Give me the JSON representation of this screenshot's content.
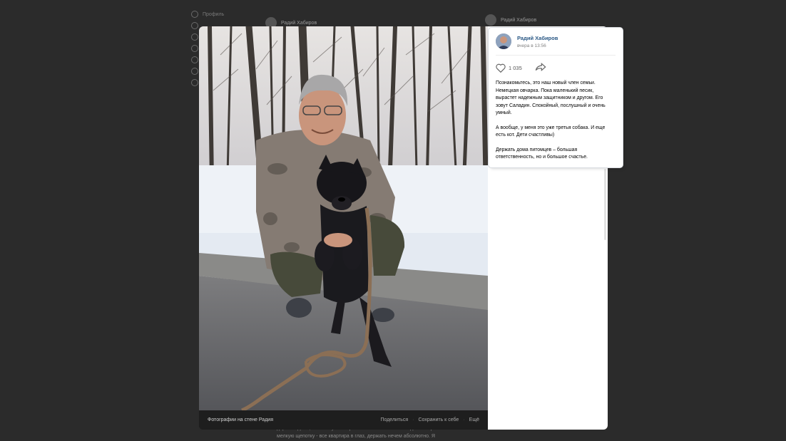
{
  "background": {
    "left_menu": [
      {
        "label": "Профиль"
      },
      {
        "label": ""
      },
      {
        "label": ""
      },
      {
        "label": ""
      },
      {
        "label": ""
      },
      {
        "label": ""
      },
      {
        "label": ""
      },
      {
        "label": ""
      },
      {
        "label": ""
      },
      {
        "label": ""
      },
      {
        "label": ""
      },
      {
        "label": ""
      },
      {
        "label": ""
      },
      {
        "label": ""
      }
    ],
    "post_author_left": "Радий Хабиров",
    "post_author_right": "Радий Хабиров",
    "post_text_under": "держите дело, что-то я уже творится в г. Салават. Сети в доме открыто на мелкую щепотку - все квартира в глаз, держать нечем абсолютно. Я"
  },
  "viewer": {
    "footer_title": "Фотографии на стене Радия",
    "footer_share": "Поделиться",
    "footer_save": "Сохранить к себе",
    "footer_more": "Ещё"
  },
  "post": {
    "author": "Радий Хабиров",
    "time": "вчера в 13:56",
    "likes": "1 035",
    "paragraph1": "Познакомьтесь, это наш новый член семьи. Немецкая овчарка. Пока маленький песик, вырастет надежным защитником и другом. Его зовут Саладин. Спокойный, послушный и очень умный.",
    "paragraph2": "А вообще, у меня это уже третья собака. И еще есть кот. Дети счастливы)",
    "paragraph3": "Держать дома питомцев – большая ответственность, но и большое счастье."
  },
  "colors": {
    "accent_link": "#2a5885",
    "viewer_bg": "#1e1e1e"
  },
  "icons": {
    "like": "heart-icon",
    "share": "share-arrow-icon"
  }
}
